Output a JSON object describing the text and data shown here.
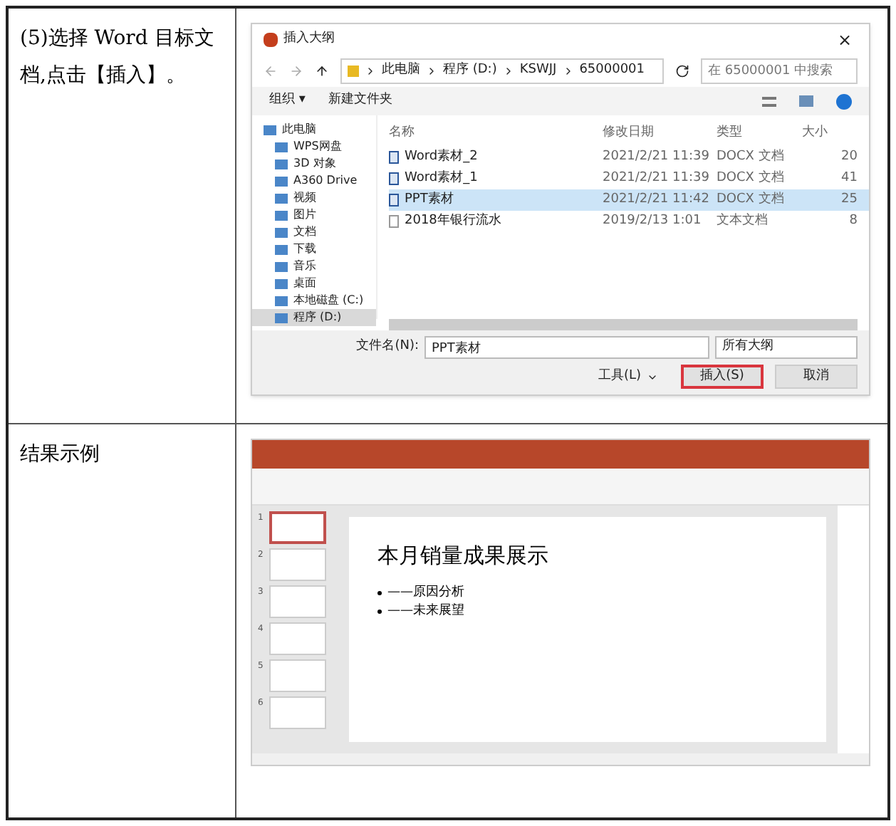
{
  "step": {
    "instruction": "(5)选择 Word 目标文档,点击【插入】。",
    "result_label": "结果示例"
  },
  "dialog": {
    "title": "插入大纲",
    "close": "×",
    "path": [
      "此电脑",
      "程序 (D:)",
      "KSWJJ",
      "65000001"
    ],
    "search": {
      "placeholder": "在 65000001 中搜索"
    },
    "toolbar": [
      "组织 ▾",
      "新建文件夹"
    ],
    "tree": [
      {
        "label": "此电脑",
        "selected": false,
        "children": [
          {
            "label": "WPS网盘",
            "selected": false
          },
          {
            "label": "3D 对象",
            "selected": false
          },
          {
            "label": "A360 Drive",
            "selected": false
          },
          {
            "label": "视频",
            "selected": false
          },
          {
            "label": "图片",
            "selected": false
          },
          {
            "label": "文档",
            "selected": false
          },
          {
            "label": "下载",
            "selected": false
          },
          {
            "label": "音乐",
            "selected": false
          },
          {
            "label": "桌面",
            "selected": false
          },
          {
            "label": "本地磁盘 (C:)",
            "selected": false
          },
          {
            "label": "程序 (D:)",
            "selected": true
          }
        ]
      }
    ],
    "columns": [
      "名称",
      "修改日期",
      "类型",
      "大小"
    ],
    "files": [
      {
        "name": "Word素材_2",
        "date": "2021/2/21 11:39",
        "type": "DOCX 文档",
        "size": "20",
        "kind": "docx",
        "selected": false
      },
      {
        "name": "Word素材_1",
        "date": "2021/2/21 11:39",
        "type": "DOCX 文档",
        "size": "41",
        "kind": "docx",
        "selected": false
      },
      {
        "name": "PPT素材",
        "date": "2021/2/21 11:42",
        "type": "DOCX 文档",
        "size": "25",
        "kind": "docx",
        "selected": true
      },
      {
        "name": "2018年银行流水",
        "date": "2019/2/13 1:01",
        "type": "文本文档",
        "size": "8",
        "kind": "txt",
        "selected": false
      }
    ],
    "filename_label": "文件名(N):",
    "filename": "PPT素材",
    "filter": "所有大纲",
    "tools": "工具(L)",
    "buttons": [
      {
        "label": "插入(S)",
        "highlighted": true
      },
      {
        "label": "取消",
        "highlighted": false
      }
    ]
  },
  "powerpoint": {
    "slides": [
      {
        "number": "1",
        "selected": true
      },
      {
        "number": "2",
        "selected": false
      },
      {
        "number": "3",
        "selected": false
      },
      {
        "number": "4",
        "selected": false
      },
      {
        "number": "5",
        "selected": false
      },
      {
        "number": "6",
        "selected": false
      }
    ],
    "slide_title": "本月销量成果展示",
    "bullets": [
      "——原因分析",
      "——未来展望"
    ]
  }
}
